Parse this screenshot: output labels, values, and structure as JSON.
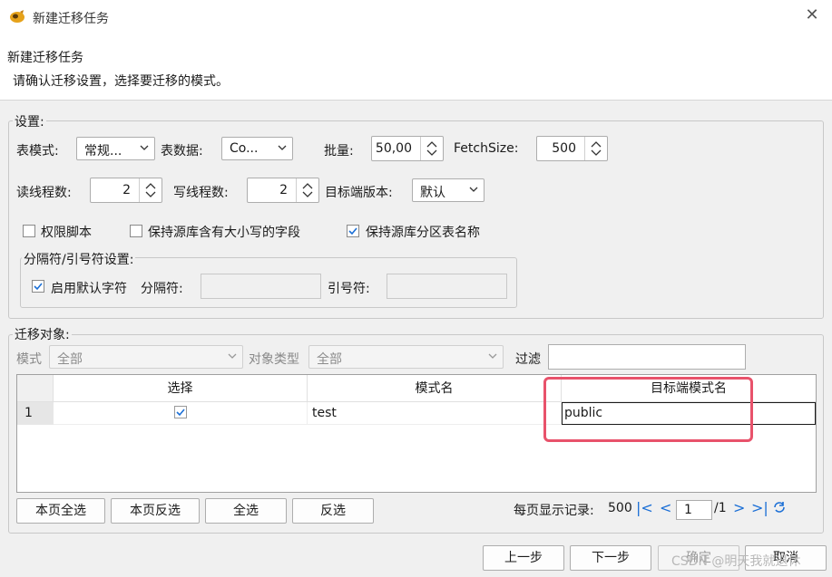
{
  "window": {
    "title": "新建迁移任务",
    "close_icon": "close-icon"
  },
  "header": {
    "title": "新建迁移任务",
    "subtitle": "请确认迁移设置，选择要迁移的模式。"
  },
  "settings": {
    "group_label": "设置:",
    "table_mode_label": "表模式:",
    "table_mode_value": "常规...",
    "table_data_label": "表数据:",
    "table_data_value": "Co...",
    "batch_label": "批量:",
    "batch_value": "50,00",
    "fetch_label": "FetchSize:",
    "fetch_value": "500",
    "read_threads_label": "读线程数:",
    "read_threads_value": "2",
    "write_threads_label": "写线程数:",
    "write_threads_value": "2",
    "target_version_label": "目标端版本:",
    "target_version_value": "默认",
    "perm_script": {
      "label": "权限脚本",
      "checked": false
    },
    "keep_case": {
      "label": "保持源库含有大小写的字段",
      "checked": false
    },
    "keep_partition": {
      "label": "保持源库分区表名称",
      "checked": true
    },
    "delimiter": {
      "group_label": "分隔符/引号符设置:",
      "use_default": {
        "label": "启用默认字符",
        "checked": true
      },
      "separator_label": "分隔符:",
      "quote_label": "引号符:"
    }
  },
  "objects": {
    "group_label": "迁移对象:",
    "mode_label": "模式",
    "mode_value": "全部",
    "type_label": "对象类型",
    "type_value": "全部",
    "filter_label": "过滤",
    "columns": [
      "选择",
      "模式名",
      "目标端模式名"
    ],
    "rows": [
      {
        "index": "1",
        "selected": true,
        "schema": "test",
        "target_schema": "public"
      }
    ],
    "buttons": {
      "page_select_all": "本页全选",
      "page_invert": "本页反选",
      "select_all": "全选",
      "invert": "反选"
    },
    "pager": {
      "label": "每页显示记录:",
      "page_size": "500",
      "current_page": "1",
      "total": "/1"
    }
  },
  "footer": {
    "prev": "上一步",
    "next": "下一步",
    "ok": "确定",
    "cancel": "取消"
  },
  "watermark": "CSDN @明天我就退休",
  "colors": {
    "accent": "#1b6fd6",
    "highlight": "#e8526b"
  }
}
